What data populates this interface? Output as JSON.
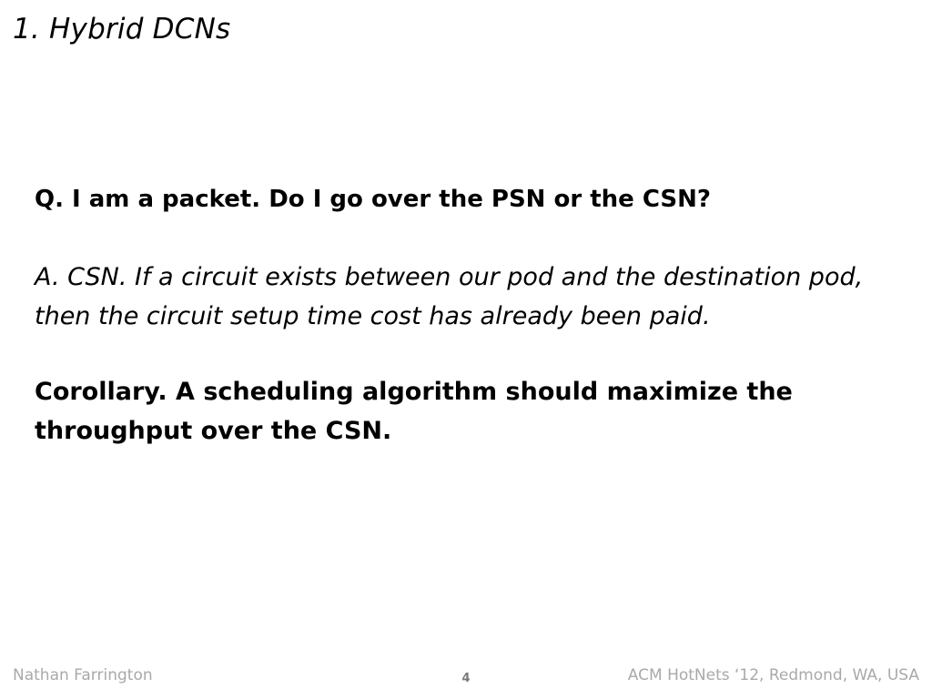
{
  "slide": {
    "title": "1. Hybrid DCNs",
    "question": "Q. I am a packet. Do I go over the PSN or the CSN?",
    "answer": "A. CSN. If a circuit exists between our pod and the destination pod, then the circuit setup time cost has already been paid.",
    "corollary": "Corollary. A scheduling algorithm should maximize the throughput over the CSN."
  },
  "footer": {
    "author": "Nathan Farrington",
    "page_number": "4",
    "venue": "ACM HotNets ‘12, Redmond, WA, USA"
  }
}
